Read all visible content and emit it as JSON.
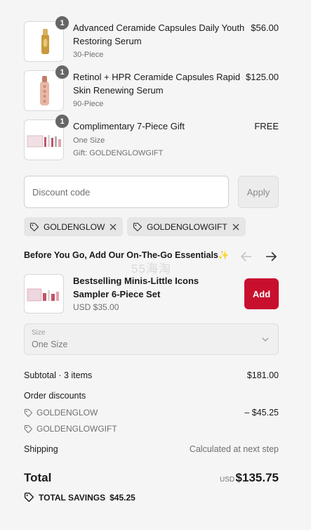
{
  "line_items": [
    {
      "qty": "1",
      "title": "Advanced Ceramide Capsules Daily Youth Restoring Serum",
      "variant": "30-Piece",
      "price": "$56.00"
    },
    {
      "qty": "1",
      "title": "Retinol + HPR Ceramide Capsules Rapid Skin Renewing Serum",
      "variant": "90-Piece",
      "price": "$125.00"
    },
    {
      "qty": "1",
      "title": "Complimentary 7-Piece Gift",
      "variant": "One Size",
      "gift_note": "Gift: GOLDENGLOWGIFT",
      "price": "FREE"
    }
  ],
  "discount": {
    "placeholder": "Discount code",
    "apply_label": "Apply",
    "codes": [
      "GOLDENGLOW",
      "GOLDENGLOWGIFT"
    ]
  },
  "upsell": {
    "heading": "Before You Go, Add Our On-The-Go Essentials",
    "heading_emoji": "✨",
    "product_title": "Bestselling Minis-Little Icons Sampler 6-Piece Set",
    "product_price": "USD $35.00",
    "add_label": "Add",
    "size_label": "Size",
    "size_value": "One Size",
    "watermark": "55海淘"
  },
  "summary": {
    "subtotal_label": "Subtotal · 3 items",
    "subtotal_value": "$181.00",
    "order_discounts_label": "Order discounts",
    "discounts": [
      {
        "code": "GOLDENGLOW",
        "amount": "– $45.25"
      },
      {
        "code": "GOLDENGLOWGIFT",
        "amount": ""
      }
    ],
    "shipping_label": "Shipping",
    "shipping_value": "Calculated at next step",
    "total_label": "Total",
    "currency": "USD",
    "total_value": "$135.75",
    "savings_label": "TOTAL SAVINGS",
    "savings_value": "$45.25"
  },
  "colors": {
    "accent": "#c8102e",
    "background": "#f5f5f5",
    "badge": "#666666"
  }
}
